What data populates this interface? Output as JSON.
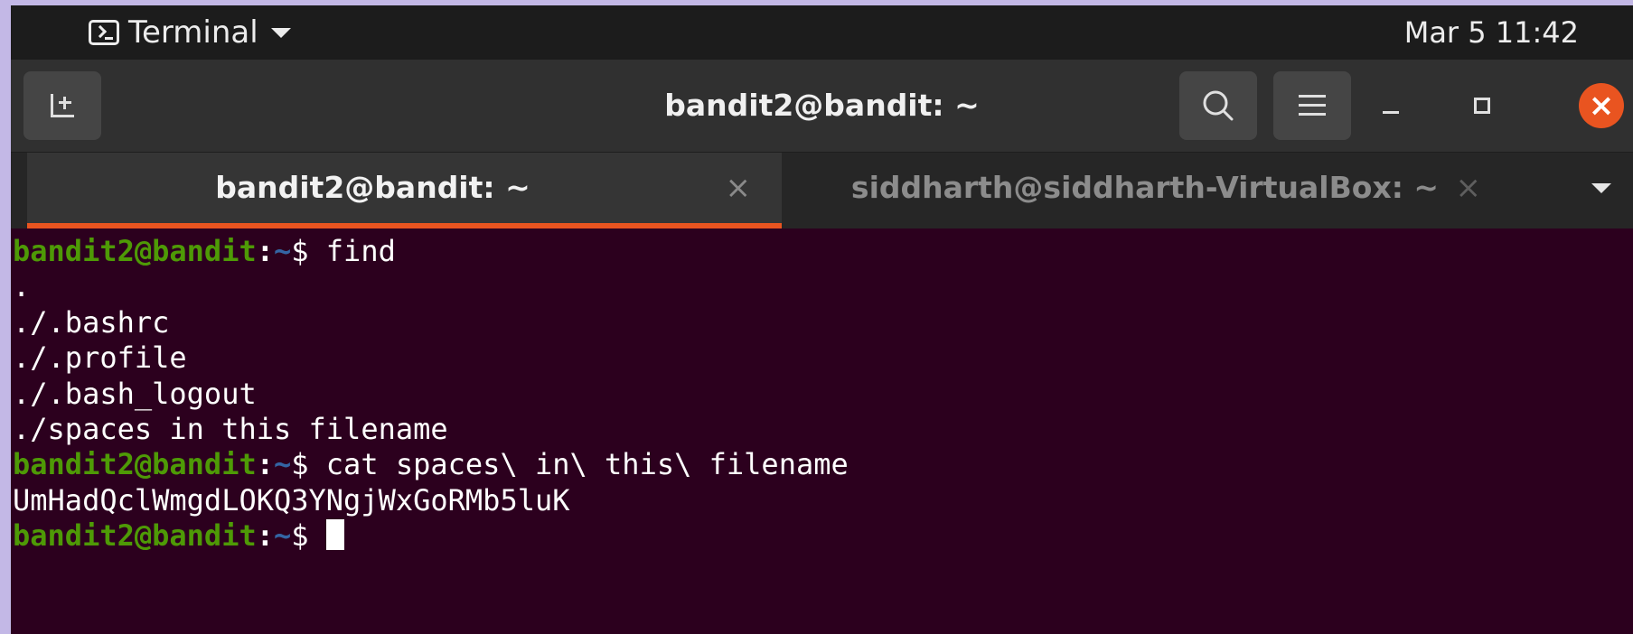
{
  "topbar": {
    "app_name": "Terminal",
    "clock": "Mar 5  11:42"
  },
  "window": {
    "title": "bandit2@bandit: ~"
  },
  "tabs": [
    {
      "label": "bandit2@bandit: ~",
      "close": "×",
      "active": true
    },
    {
      "label": "siddharth@siddharth-VirtualBox: ~",
      "close": "×",
      "active": false
    }
  ],
  "controls": {
    "close_glyph": "×"
  },
  "terminal": {
    "prompt_user": "bandit2@bandit",
    "prompt_colon": ":",
    "prompt_path": "~",
    "prompt_symbol": "$ ",
    "lines": [
      {
        "type": "prompt",
        "command": "find"
      },
      {
        "type": "output",
        "text": "."
      },
      {
        "type": "output",
        "text": "./.bashrc"
      },
      {
        "type": "output",
        "text": "./.profile"
      },
      {
        "type": "output",
        "text": "./.bash_logout"
      },
      {
        "type": "output",
        "text": "./spaces in this filename"
      },
      {
        "type": "prompt",
        "command": "cat spaces\\ in\\ this\\ filename"
      },
      {
        "type": "output",
        "text": "UmHadQclWmgdLOKQ3YNgjWxGoRMb5luK"
      },
      {
        "type": "prompt",
        "command": "",
        "cursor": true
      }
    ]
  },
  "colors": {
    "terminal_bg": "#2c001e",
    "prompt_user": "#4e9a06",
    "prompt_path": "#3465a4",
    "accent": "#e95420"
  }
}
